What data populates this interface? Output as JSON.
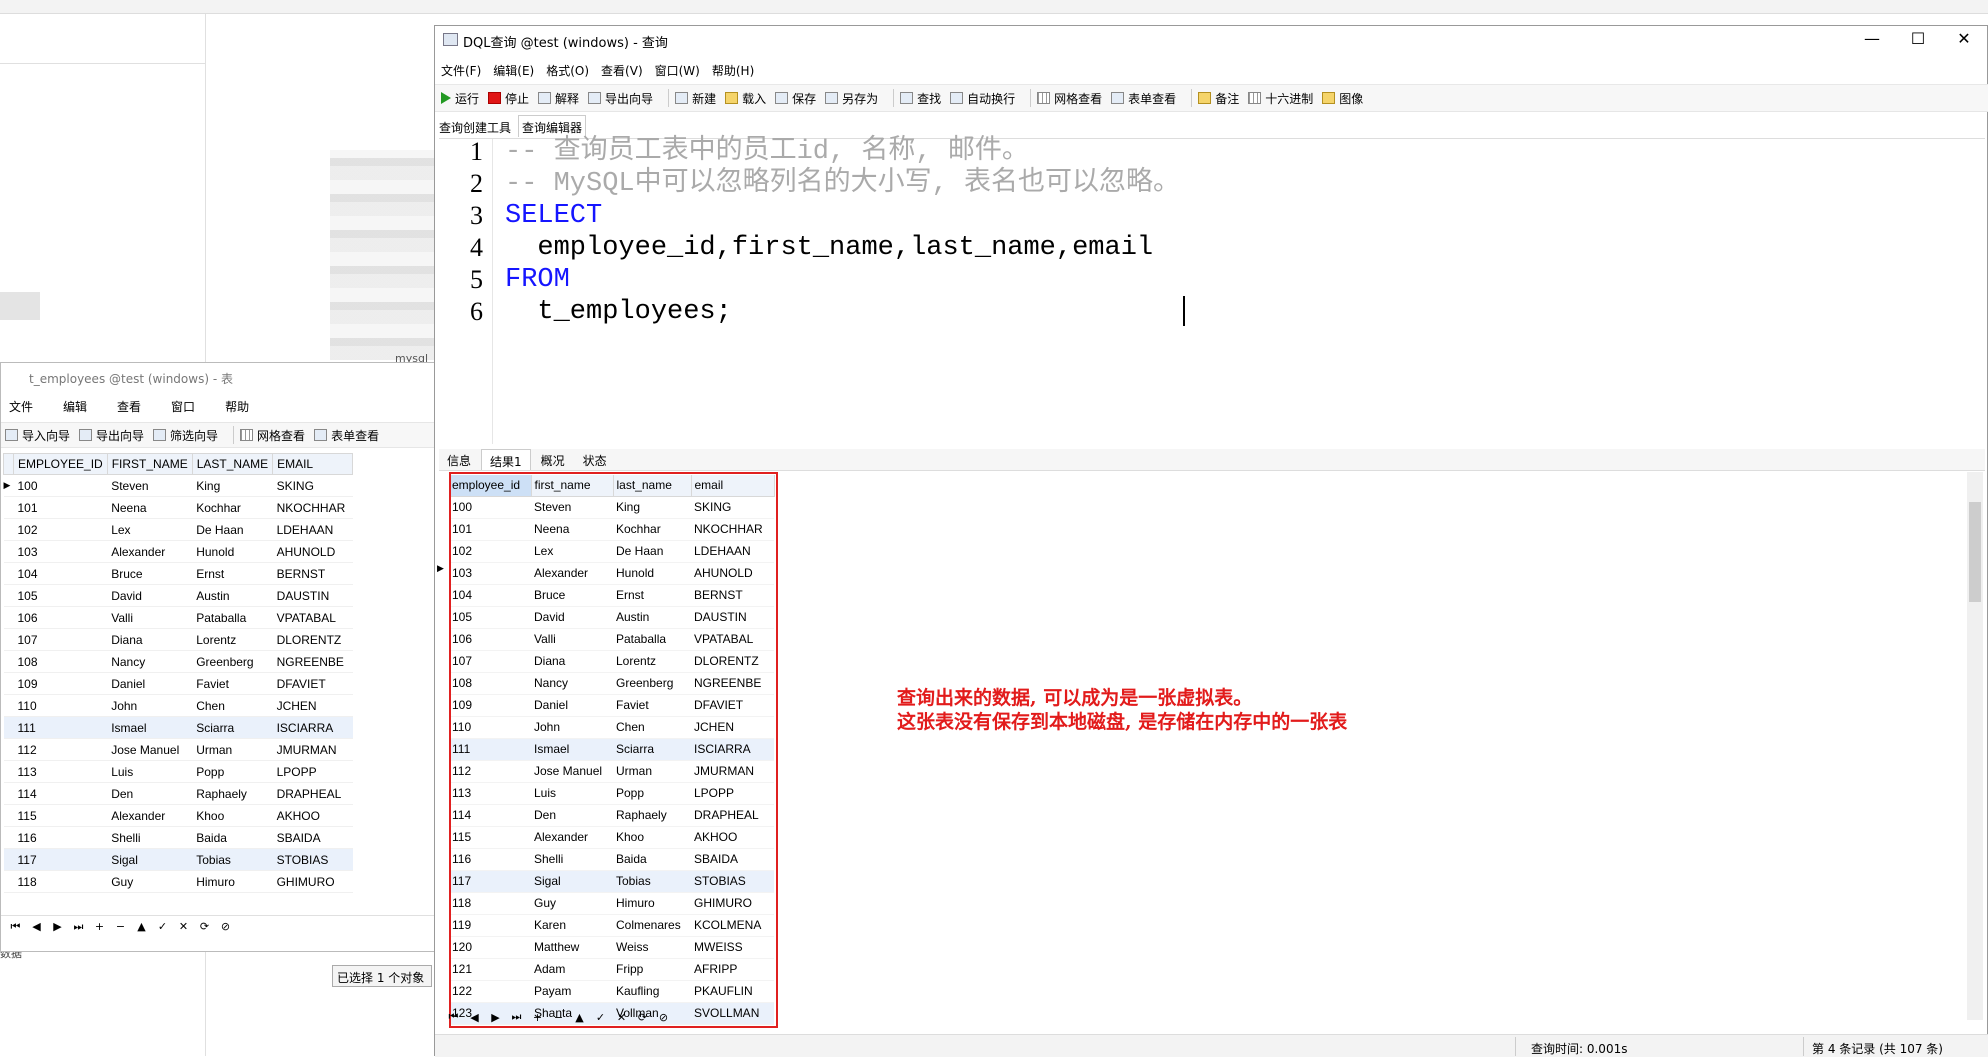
{
  "background": {
    "status_text": "已选择 1 个对象",
    "mysql_label": "mysql",
    "left_text": "数据"
  },
  "left_window": {
    "title": "t_employees @test (windows) - 表",
    "menu": [
      "文件",
      "编辑",
      "查看",
      "窗口",
      "帮助"
    ],
    "toolbar": [
      {
        "icon": "import-icon",
        "label": "导入向导"
      },
      {
        "icon": "export-icon",
        "label": "导出向导"
      },
      {
        "icon": "filter-icon",
        "label": "筛选向导"
      },
      {
        "icon": "grid-view-icon",
        "label": "网格查看"
      },
      {
        "icon": "form-view-icon",
        "label": "表单查看"
      }
    ],
    "columns": [
      "EMPLOYEE_ID",
      "FIRST_NAME",
      "LAST_NAME",
      "EMAIL"
    ],
    "rows": [
      [
        "100",
        "Steven",
        "King",
        "SKING"
      ],
      [
        "101",
        "Neena",
        "Kochhar",
        "NKOCHHAR"
      ],
      [
        "102",
        "Lex",
        "De Haan",
        "LDEHAAN"
      ],
      [
        "103",
        "Alexander",
        "Hunold",
        "AHUNOLD"
      ],
      [
        "104",
        "Bruce",
        "Ernst",
        "BERNST"
      ],
      [
        "105",
        "David",
        "Austin",
        "DAUSTIN"
      ],
      [
        "106",
        "Valli",
        "Pataballa",
        "VPATABAL"
      ],
      [
        "107",
        "Diana",
        "Lorentz",
        "DLORENTZ"
      ],
      [
        "108",
        "Nancy",
        "Greenberg",
        "NGREENBE"
      ],
      [
        "109",
        "Daniel",
        "Faviet",
        "DFAVIET"
      ],
      [
        "110",
        "John",
        "Chen",
        "JCHEN"
      ],
      [
        "111",
        "Ismael",
        "Sciarra",
        "ISCIARRA"
      ],
      [
        "112",
        "Jose Manuel",
        "Urman",
        "JMURMAN"
      ],
      [
        "113",
        "Luis",
        "Popp",
        "LPOPP"
      ],
      [
        "114",
        "Den",
        "Raphaely",
        "DRAPHEAL"
      ],
      [
        "115",
        "Alexander",
        "Khoo",
        "AKHOO"
      ],
      [
        "116",
        "Shelli",
        "Baida",
        "SBAIDA"
      ],
      [
        "117",
        "Sigal",
        "Tobias",
        "STOBIAS"
      ],
      [
        "118",
        "Guy",
        "Himuro",
        "GHIMURO"
      ]
    ],
    "nav": [
      "⏮",
      "◀",
      "▶",
      "⏭",
      "+",
      "−",
      "▲",
      "✓",
      "✕",
      "⟳",
      "⊘"
    ]
  },
  "main_window": {
    "title": "DQL查询 @test (windows) - 查询",
    "controls": [
      "—",
      "☐",
      "✕"
    ],
    "menu": [
      "文件(F)",
      "编辑(E)",
      "格式(O)",
      "查看(V)",
      "窗口(W)",
      "帮助(H)"
    ],
    "toolbar": [
      {
        "icon": "run-icon",
        "label": "运行"
      },
      {
        "icon": "stop-icon",
        "label": "停止"
      },
      {
        "icon": "explain-icon",
        "label": "解释"
      },
      {
        "icon": "export-icon",
        "label": "导出向导"
      },
      {
        "icon": "new-icon",
        "label": "新建"
      },
      {
        "icon": "load-icon",
        "label": "载入"
      },
      {
        "icon": "save-icon",
        "label": "保存"
      },
      {
        "icon": "save-as-icon",
        "label": "另存为"
      },
      {
        "icon": "find-icon",
        "label": "查找"
      },
      {
        "icon": "wrap-icon",
        "label": "自动换行"
      },
      {
        "icon": "grid-view-icon",
        "label": "网格查看"
      },
      {
        "icon": "form-view-icon",
        "label": "表单查看"
      },
      {
        "icon": "memo-icon",
        "label": "备注"
      },
      {
        "icon": "hex-icon",
        "label": "十六进制"
      },
      {
        "icon": "image-icon",
        "label": "图像"
      }
    ],
    "tabs": [
      "查询创建工具",
      "查询编辑器"
    ],
    "code_lines": [
      {
        "n": "1",
        "text": "-- 查询员工表中的员工id, 名称, 邮件。",
        "kind": "cmt"
      },
      {
        "n": "2",
        "text": "-- MySQL中可以忽略列名的大小写, 表名也可以忽略。",
        "kind": "cmt"
      },
      {
        "n": "3",
        "text": "SELECT",
        "kind": "kw"
      },
      {
        "n": "4",
        "text": "  employee_id,first_name,last_name,email",
        "kind": "txt"
      },
      {
        "n": "5",
        "text": "FROM",
        "kind": "kw"
      },
      {
        "n": "6",
        "text": "  t_employees;",
        "kind": "txt"
      }
    ],
    "result_tabs": [
      "信息",
      "结果1",
      "概况",
      "状态"
    ],
    "result_columns": [
      "employee_id",
      "first_name",
      "last_name",
      "email"
    ],
    "result_rows": [
      [
        "100",
        "Steven",
        "King",
        "SKING"
      ],
      [
        "101",
        "Neena",
        "Kochhar",
        "NKOCHHAR"
      ],
      [
        "102",
        "Lex",
        "De Haan",
        "LDEHAAN"
      ],
      [
        "103",
        "Alexander",
        "Hunold",
        "AHUNOLD"
      ],
      [
        "104",
        "Bruce",
        "Ernst",
        "BERNST"
      ],
      [
        "105",
        "David",
        "Austin",
        "DAUSTIN"
      ],
      [
        "106",
        "Valli",
        "Pataballa",
        "VPATABAL"
      ],
      [
        "107",
        "Diana",
        "Lorentz",
        "DLORENTZ"
      ],
      [
        "108",
        "Nancy",
        "Greenberg",
        "NGREENBE"
      ],
      [
        "109",
        "Daniel",
        "Faviet",
        "DFAVIET"
      ],
      [
        "110",
        "John",
        "Chen",
        "JCHEN"
      ],
      [
        "111",
        "Ismael",
        "Sciarra",
        "ISCIARRA"
      ],
      [
        "112",
        "Jose Manuel",
        "Urman",
        "JMURMAN"
      ],
      [
        "113",
        "Luis",
        "Popp",
        "LPOPP"
      ],
      [
        "114",
        "Den",
        "Raphaely",
        "DRAPHEAL"
      ],
      [
        "115",
        "Alexander",
        "Khoo",
        "AKHOO"
      ],
      [
        "116",
        "Shelli",
        "Baida",
        "SBAIDA"
      ],
      [
        "117",
        "Sigal",
        "Tobias",
        "STOBIAS"
      ],
      [
        "118",
        "Guy",
        "Himuro",
        "GHIMURO"
      ],
      [
        "119",
        "Karen",
        "Colmenares",
        "KCOLMENA"
      ],
      [
        "120",
        "Matthew",
        "Weiss",
        "MWEISS"
      ],
      [
        "121",
        "Adam",
        "Fripp",
        "AFRIPP"
      ],
      [
        "122",
        "Payam",
        "Kaufling",
        "PKAUFLIN"
      ],
      [
        "123",
        "Shanta",
        "Vollman",
        "SVOLLMAN"
      ]
    ],
    "annotation": "查询出来的数据, 可以成为是一张虚拟表。\n这张表没有保存到本地磁盘, 是存储在内存中的一张表",
    "status": {
      "query_time": "查询时间: 0.001s",
      "record": "第 4 条记录 (共 107 条)"
    }
  }
}
